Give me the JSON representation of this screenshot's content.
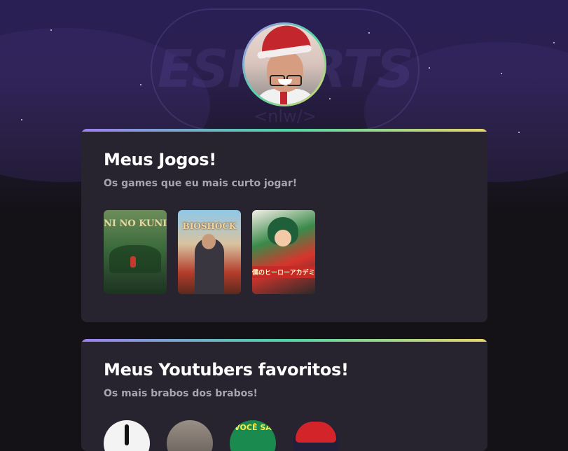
{
  "profile": {
    "avatar_icon": "profile-photo-icon"
  },
  "background": {
    "logo_text": "ESPORTS",
    "logo_sub": "<nlw/>"
  },
  "games_section": {
    "title": "Meus Jogos!",
    "subtitle": "Os games que eu mais curto jogar!",
    "games": [
      {
        "cover_text": "NI NO KUNI"
      },
      {
        "cover_text": "BIOSHOCK"
      },
      {
        "cover_text": "僕のヒーローアカデミア"
      }
    ]
  },
  "youtubers_section": {
    "title": "Meus Youtubers favoritos!",
    "subtitle": "Os mais brabos dos brabos!",
    "channels": [
      {
        "icon": "channel-1-avatar-icon"
      },
      {
        "icon": "channel-2-avatar-icon"
      },
      {
        "icon": "channel-3-avatar-icon",
        "text": "VOCÊ SA"
      },
      {
        "icon": "channel-4-avatar-icon"
      }
    ]
  },
  "colors": {
    "accent_gradient": [
      "#9d7ff2",
      "#4fd6a8",
      "#e9d56a"
    ],
    "card_bg": "#28242f",
    "page_bg": "#141217"
  }
}
